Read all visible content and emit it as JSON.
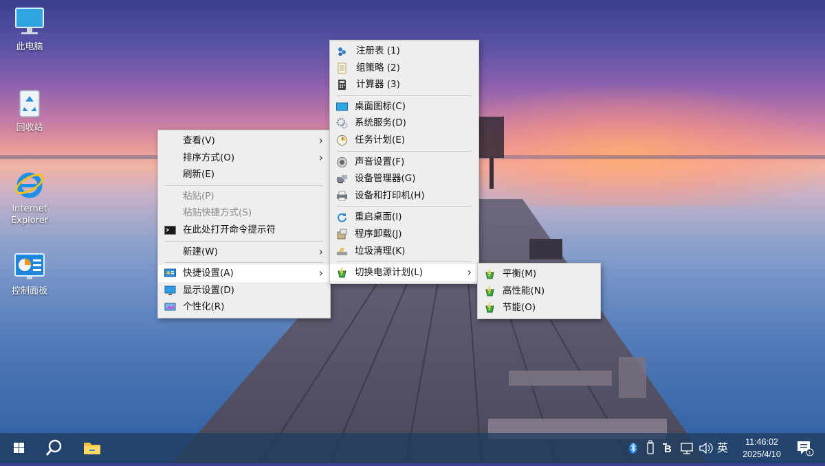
{
  "desktop": {
    "icons": [
      {
        "label": "此电脑",
        "icon": "monitor-icon"
      },
      {
        "label": "回收站",
        "icon": "recycle-bin-icon"
      },
      {
        "label": "Internet\nExplorer",
        "icon": "internet-explorer-icon"
      },
      {
        "label": "控制面板",
        "icon": "control-panel-icon"
      }
    ]
  },
  "context_menu": {
    "items": [
      {
        "label": "查看(V)",
        "submenu": true
      },
      {
        "label": "排序方式(O)",
        "submenu": true
      },
      {
        "label": "刷新(E)"
      },
      {
        "label": "粘贴(P)",
        "disabled": true
      },
      {
        "label": "粘贴快捷方式(S)",
        "disabled": true
      },
      {
        "label": "在此处打开命令提示符",
        "icon": "cmd-icon"
      },
      {
        "label": "新建(W)",
        "submenu": true
      },
      {
        "label": "快捷设置(A)",
        "submenu": true,
        "icon": "quick-settings-icon",
        "highlighted": true
      },
      {
        "label": "显示设置(D)",
        "icon": "display-icon"
      },
      {
        "label": "个性化(R)",
        "icon": "personalize-icon"
      }
    ]
  },
  "quick_settings_menu": {
    "items": [
      {
        "label": "注册表 (1)",
        "icon": "registry-icon"
      },
      {
        "label": "组策略 (2)",
        "icon": "group-policy-icon"
      },
      {
        "label": "计算器 (3)",
        "icon": "calculator-icon"
      },
      {
        "label": "桌面图标(C)",
        "icon": "desktop-icons-icon"
      },
      {
        "label": "系统服务(D)",
        "icon": "services-icon"
      },
      {
        "label": "任务计划(E)",
        "icon": "task-scheduler-icon"
      },
      {
        "label": "声音设置(F)",
        "icon": "sound-icon"
      },
      {
        "label": "设备管理器(G)",
        "icon": "device-manager-icon"
      },
      {
        "label": "设备和打印机(H)",
        "icon": "printer-icon"
      },
      {
        "label": "重启桌面(I)",
        "icon": "restart-icon"
      },
      {
        "label": "程序卸载(J)",
        "icon": "uninstall-icon"
      },
      {
        "label": "垃圾清理(K)",
        "icon": "cleanup-icon"
      },
      {
        "label": "切换电源计划(L)",
        "icon": "power-plan-icon",
        "submenu": true,
        "highlighted": true
      }
    ]
  },
  "power_plan_menu": {
    "items": [
      {
        "label": "平衡(M)",
        "icon": "power-plan-icon"
      },
      {
        "label": "高性能(N)",
        "icon": "power-plan-icon"
      },
      {
        "label": "节能(O)",
        "icon": "power-plan-icon"
      }
    ]
  },
  "taskbar": {
    "start": "windows-start-icon",
    "search": "search-icon",
    "explorer": "file-explorer-icon",
    "tray": {
      "bluetooth": "bluetooth-icon",
      "usb": "usb-icon",
      "app": "b-app-icon",
      "network": "network-icon",
      "volume": "volume-icon",
      "ime": "英"
    },
    "time": "11:46:02",
    "date": "2025/4/10",
    "notification": "notification-icon"
  },
  "colors": {
    "menu_bg": "#eeeeee",
    "menu_highlight": "#ffffff",
    "taskbar": "#203c5f"
  }
}
